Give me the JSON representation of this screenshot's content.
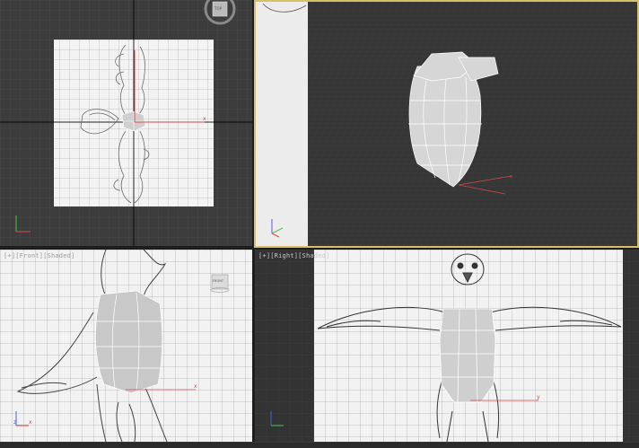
{
  "viewports": {
    "top_left": {
      "label": "",
      "viewcube_label": "TOP"
    },
    "perspective": {
      "label": ""
    },
    "front": {
      "label": "[+][Front][Shaded]",
      "viewcube_label": "FRONT"
    },
    "right": {
      "label": "[+][Right][Shaded]"
    }
  },
  "axes": {
    "x": "x",
    "y": "y",
    "z": "z"
  },
  "colors": {
    "viewport_bg_dark": "#3b3b3b",
    "grid_line": "#5a5a5a",
    "reference_plane": "#f2f2f2",
    "active_border": "#d8c06a",
    "axis_x": "#d44a4a",
    "axis_y": "#4ac04a",
    "axis_z": "#4a64d8"
  }
}
